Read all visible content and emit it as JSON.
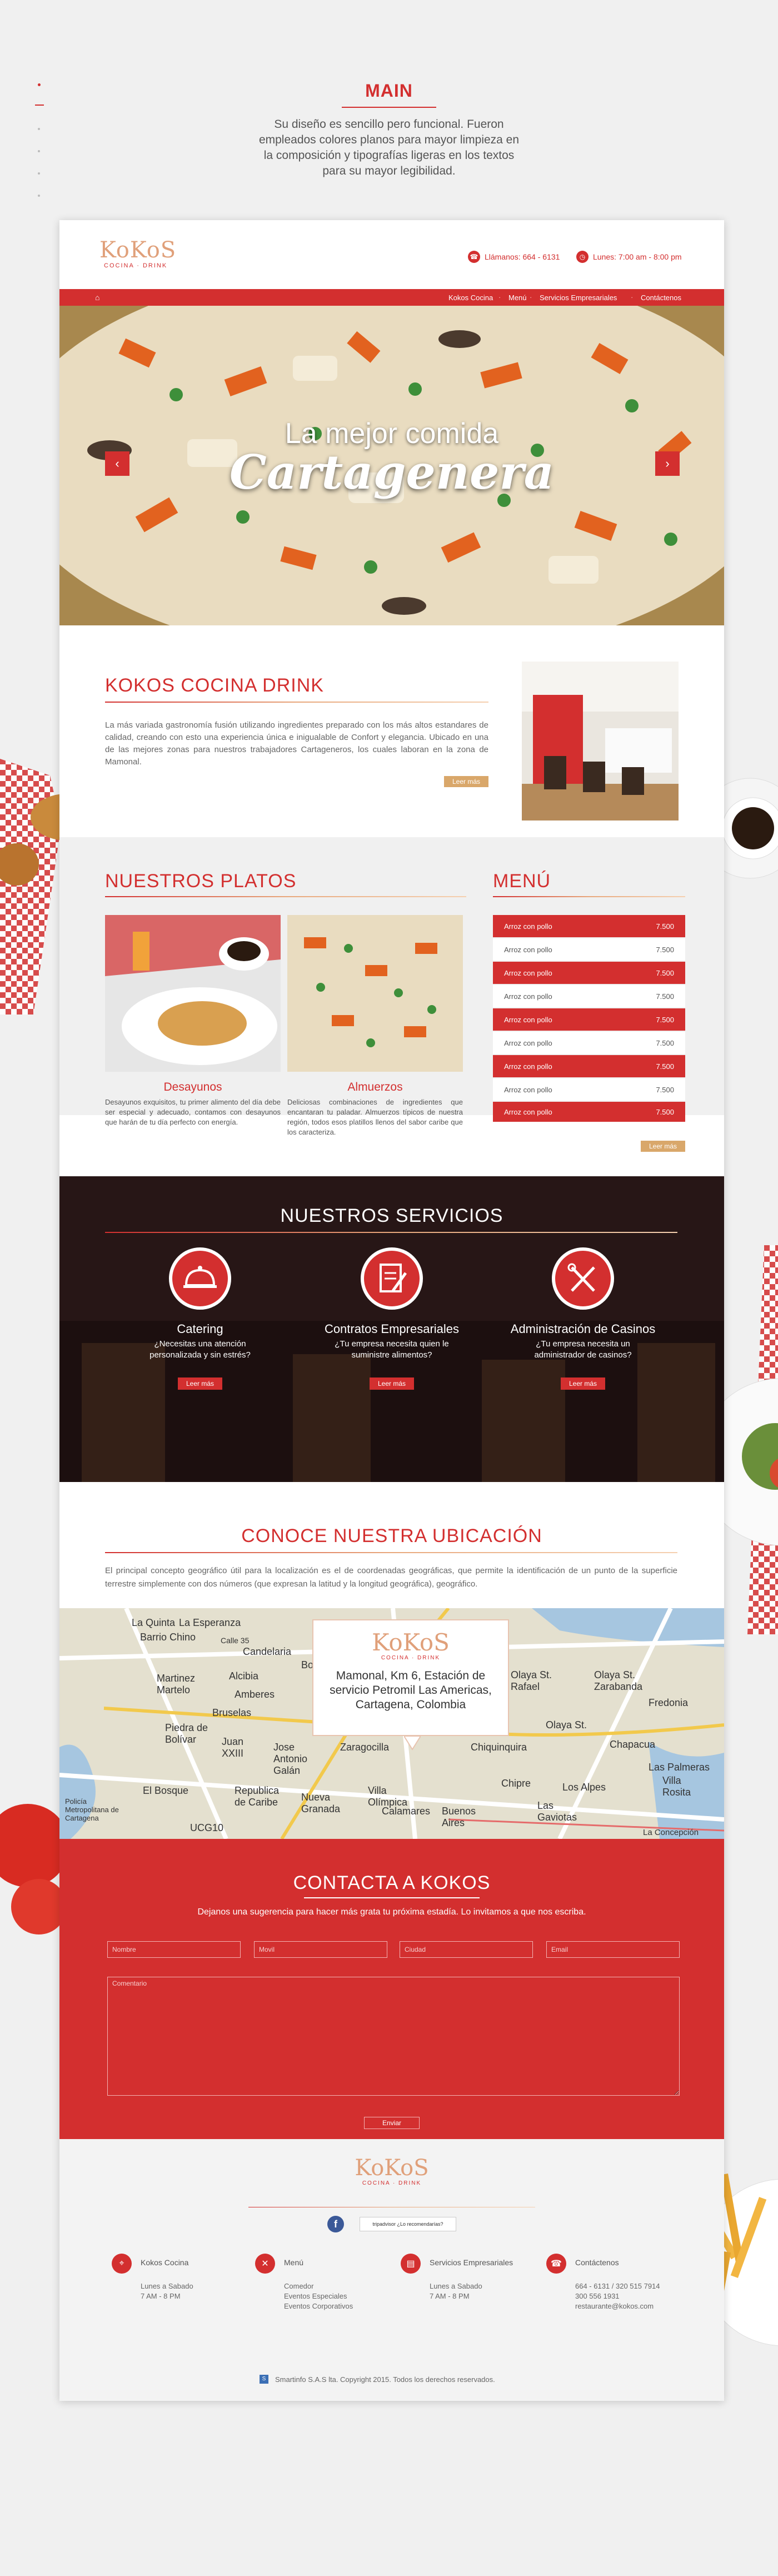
{
  "presentation": {
    "title": "MAIN",
    "description": "Su diseño es sencillo pero funcional. Fueron empleados colores planos para mayor limpieza en la composición y tipografías ligeras en los textos para su mayor legibilidad."
  },
  "header": {
    "logo_text": "KoKoS",
    "logo_sub": "COCINA · DRINK",
    "phone": "Llámanos: 664 - 6131",
    "hours": "Lunes: 7:00 am - 8:00 pm"
  },
  "nav": {
    "items": [
      "Kokos Cocina",
      "Menú",
      "Servicios Empresariales",
      "Contáctenos"
    ]
  },
  "hero": {
    "line1": "La mejor comida",
    "line2": "Cartagenera",
    "prev": "‹",
    "next": "›"
  },
  "about": {
    "title": "KOKOS COCINA DRINK",
    "text": "La más variada gastronomía fusión utilizando ingredientes preparado con los más altos estandares de calidad, creando con esto una experiencia única e inigualable de Confort y elegancia. Ubicado en una de las mejores zonas para nuestros trabajadores Cartageneros, los cuales laboran en la zona de Mamonal.",
    "button": "Leer más"
  },
  "platos": {
    "title": "NUESTROS PLATOS",
    "dishes": [
      {
        "title": "Desayunos",
        "text": "Desayunos exquisitos, tu primer alimento del día debe ser especial y adecuado, contamos con desayunos que harán de tu día perfecto con energía."
      },
      {
        "title": "Almuerzos",
        "text": "Deliciosas combinaciones de ingredientes que encantaran tu paladar. Almuerzos típicos de nuestra región, todos esos platillos llenos del sabor caribe que los caracteriza."
      }
    ]
  },
  "menu": {
    "title": "MENÚ",
    "items": [
      {
        "name": "Arroz con pollo",
        "price": "7.500"
      },
      {
        "name": "Arroz con pollo",
        "price": "7.500"
      },
      {
        "name": "Arroz con pollo",
        "price": "7.500"
      },
      {
        "name": "Arroz con pollo",
        "price": "7.500"
      },
      {
        "name": "Arroz con pollo",
        "price": "7.500"
      },
      {
        "name": "Arroz con pollo",
        "price": "7.500"
      },
      {
        "name": "Arroz con pollo",
        "price": "7.500"
      },
      {
        "name": "Arroz con pollo",
        "price": "7.500"
      },
      {
        "name": "Arroz con pollo",
        "price": "7.500"
      }
    ],
    "button": "Leer más"
  },
  "servicios": {
    "title": "NUESTROS SERVICIOS",
    "items": [
      {
        "title": "Catering",
        "text": "¿Necesitas una atención personalizada y sin estrés?",
        "button": "Leer más"
      },
      {
        "title": "Contratos Empresariales",
        "text": "¿Tu empresa necesita quien le suministre alimentos?",
        "button": "Leer más"
      },
      {
        "title": "Administración de Casinos",
        "text": "¿Tu empresa necesita un administrador de casinos?",
        "button": "Leer más"
      }
    ]
  },
  "ubicacion": {
    "title": "CONOCE NUESTRA UBICACIÓN",
    "text": "El principal concepto geográfico útil para la localización es el de coordenadas geográficas, que permite la identificación de un punto de la superficie terrestre simplemente con dos números (que expresan la latitud y la longitud geográfica), geográfico.",
    "card_address": "Mamonal, Km 6, Estación de servicio Petromil Las Americas, Cartagena, Colombia",
    "labels": [
      "La Quinta",
      "La Esperanza",
      "Barrio Chino",
      "Calle 35",
      "Candelaria",
      "Bo",
      "Martinez Martelo",
      "Alcibia",
      "Amberes",
      "Bruselas",
      "Piedra de Bolívar",
      "Juan XXIII",
      "Jose Antonio Galán",
      "Zaragocilla",
      "El Bosque",
      "Republica de Caribe",
      "Nueva Granada",
      "Villa Olímpica",
      "Calamares",
      "Buenos Aires",
      "Las Gaviotas",
      "Olaya St. Rafael",
      "Olaya St. Zarabanda",
      "Fredonia",
      "Olaya St.",
      "Chapacua",
      "Los Alpes",
      "Las Palmeras",
      "Villa Rosita",
      "La Concepción",
      "Chipre",
      "Chiquinquira",
      "UCG10",
      "Policía Metropolitana de Cartagena"
    ]
  },
  "contacto": {
    "title": "CONTACTA A KOKOS",
    "desc": "Dejanos una sugerencia para hacer más grata tu próxima estadía. Lo invitamos a que nos escriba.",
    "placeholders": {
      "name": "Nombre",
      "mobile": "Movil",
      "city": "Ciudad",
      "email": "Email",
      "comment": "Comentario"
    },
    "submit": "Enviar"
  },
  "footer": {
    "logo_text": "KoKoS",
    "logo_sub": "COCINA · DRINK",
    "tripadvisor": "tripadvisor ¿Lo recomendarías?",
    "cols": [
      {
        "title": "Kokos Cocina",
        "lines": [
          "Lunes a Sabado",
          "7 AM - 8 PM"
        ]
      },
      {
        "title": "Menú",
        "lines": [
          "Comedor",
          "Eventos Especiales",
          "Eventos Corporativos"
        ]
      },
      {
        "title": "Servicios Empresariales",
        "lines": [
          "Lunes a Sabado",
          "7 AM - 8 PM"
        ]
      },
      {
        "title": "Contáctenos",
        "lines": [
          "664 - 6131 / 320 515 7914",
          "300 556 1931",
          "restaurante@kokos.com"
        ]
      }
    ],
    "copyright": "Smartinfo S.A.S lta. Copyright 2015. Todos los derechos reservados."
  },
  "colors": {
    "accent": "#d32f2f",
    "gold": "#d9a76a",
    "footer_bg": "#f3f3f3"
  }
}
